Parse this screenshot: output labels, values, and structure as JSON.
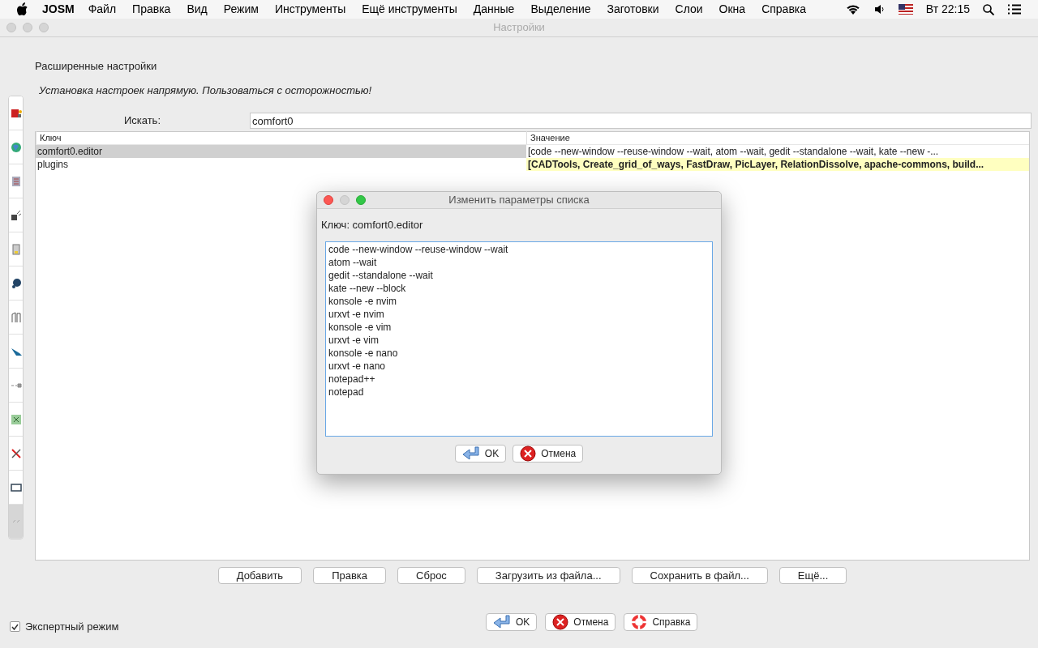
{
  "menu_bar": {
    "app": "JOSM",
    "items": [
      "Файл",
      "Правка",
      "Вид",
      "Режим",
      "Инструменты",
      "Ещё инструменты",
      "Данные",
      "Выделение",
      "Заготовки",
      "Слои",
      "Окна",
      "Справка"
    ],
    "clock": "Вт 22:15"
  },
  "window": {
    "title": "Настройки"
  },
  "sidebar_tabs": [
    {
      "selected": false
    },
    {
      "selected": false
    },
    {
      "selected": false
    },
    {
      "selected": false
    },
    {
      "selected": false
    },
    {
      "selected": false
    },
    {
      "selected": false
    },
    {
      "selected": false
    },
    {
      "selected": false
    },
    {
      "selected": false
    },
    {
      "selected": false
    },
    {
      "selected": false
    },
    {
      "selected": true
    }
  ],
  "panel": {
    "title": "Расширенные настройки",
    "warning": "Установка настроек напрямую. Пользоваться с осторожностью!",
    "search_label": "Искать:",
    "search_value": "comfort0"
  },
  "table": {
    "columns": [
      "Ключ",
      "Значение"
    ],
    "rows": [
      {
        "key": "comfort0.editor",
        "value": "[code --new-window --reuse-window --wait, atom --wait, gedit --standalone --wait, kate --new -...",
        "selected": true,
        "modified": false
      },
      {
        "key": "plugins",
        "value": "[CADTools, Create_grid_of_ways, FastDraw, PicLayer, RelationDissolve, apache-commons, build...",
        "selected": false,
        "modified": true
      }
    ]
  },
  "panel_buttons": [
    "Добавить",
    "Правка",
    "Сброс",
    "Загрузить из файла...",
    "Сохранить в файл...",
    "Ещё..."
  ],
  "expert_mode": {
    "label": "Экспертный режим",
    "checked": true
  },
  "footer_buttons": [
    {
      "kind": "ok",
      "label": "OK"
    },
    {
      "kind": "cancel",
      "label": "Отмена"
    },
    {
      "kind": "help",
      "label": "Справка"
    }
  ],
  "dialog": {
    "title": "Изменить параметры списка",
    "key_label": "Ключ: comfort0.editor",
    "lines": [
      "code --new-window --reuse-window --wait",
      "atom --wait",
      "gedit --standalone --wait",
      "kate --new --block",
      "konsole -e nvim",
      "urxvt -e nvim",
      "konsole -e vim",
      "urxvt -e vim",
      "konsole -e nano",
      "urxvt -e nano",
      "notepad++",
      "notepad"
    ],
    "buttons": [
      {
        "kind": "ok",
        "label": "OK"
      },
      {
        "kind": "cancel",
        "label": "Отмена"
      }
    ]
  }
}
